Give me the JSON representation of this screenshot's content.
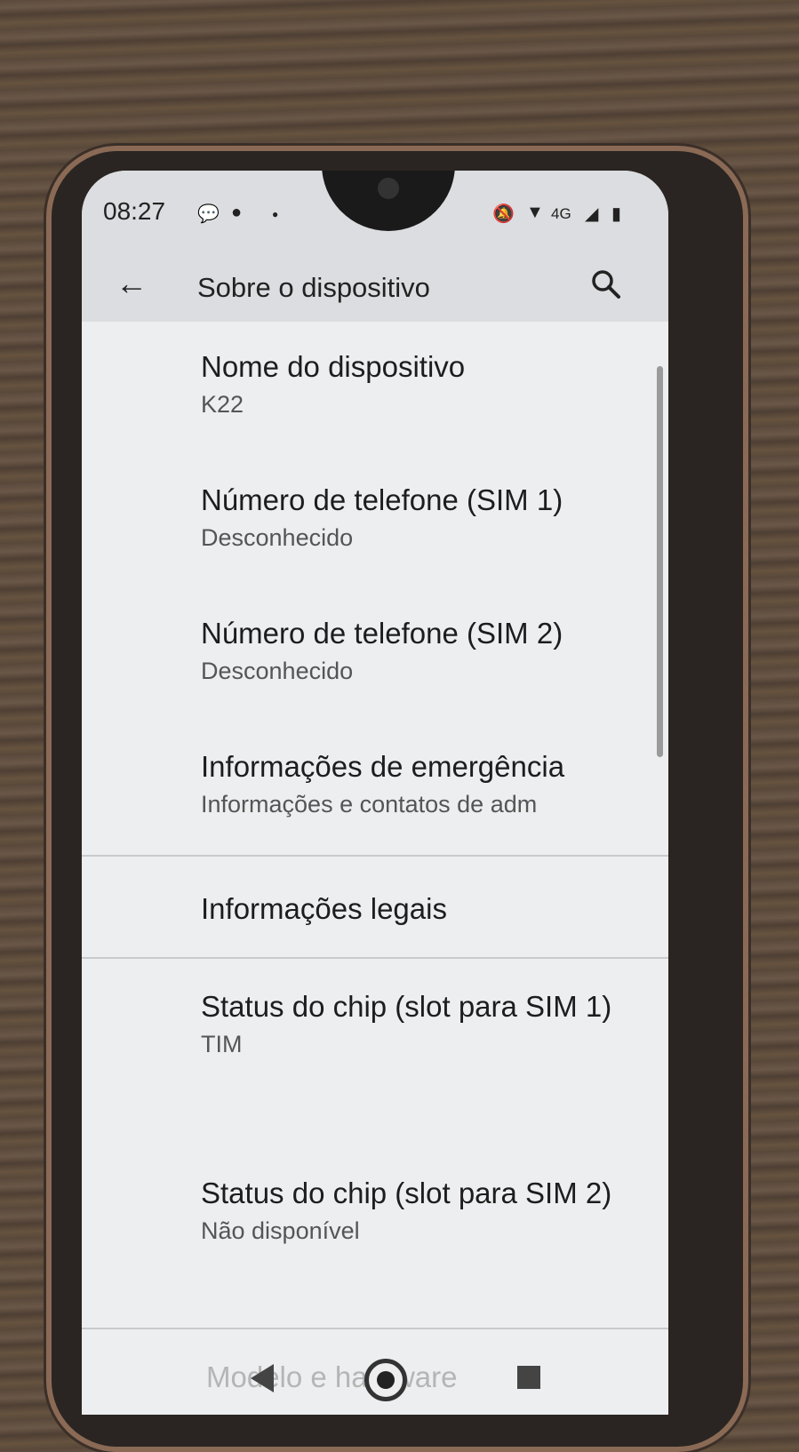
{
  "status_bar": {
    "time": "08:27"
  },
  "app_bar": {
    "title": "Sobre o dispositivo"
  },
  "items": [
    {
      "title": "Nome do dispositivo",
      "subtitle": "K22"
    },
    {
      "title": "Número de telefone (SIM 1)",
      "subtitle": "Desconhecido"
    },
    {
      "title": "Número de telefone (SIM 2)",
      "subtitle": "Desconhecido"
    },
    {
      "title": "Informações de emergência",
      "subtitle": "Informações e contatos de adm"
    },
    {
      "title": "Informações legais"
    },
    {
      "title": "Status do chip (slot para SIM 1)",
      "subtitle": "TIM"
    },
    {
      "title": "Status do chip (slot para SIM 2)",
      "subtitle": "Não disponível"
    },
    {
      "title": "Modelo e hardware"
    }
  ],
  "status_icons": [
    "message-icon",
    "notification-icon",
    "dot-icon",
    "mute-icon",
    "wifi-icon",
    "4g-icon",
    "signal-icon",
    "battery-icon"
  ],
  "nav": [
    "back-nav-icon",
    "home-nav-icon",
    "recents-nav-icon"
  ]
}
